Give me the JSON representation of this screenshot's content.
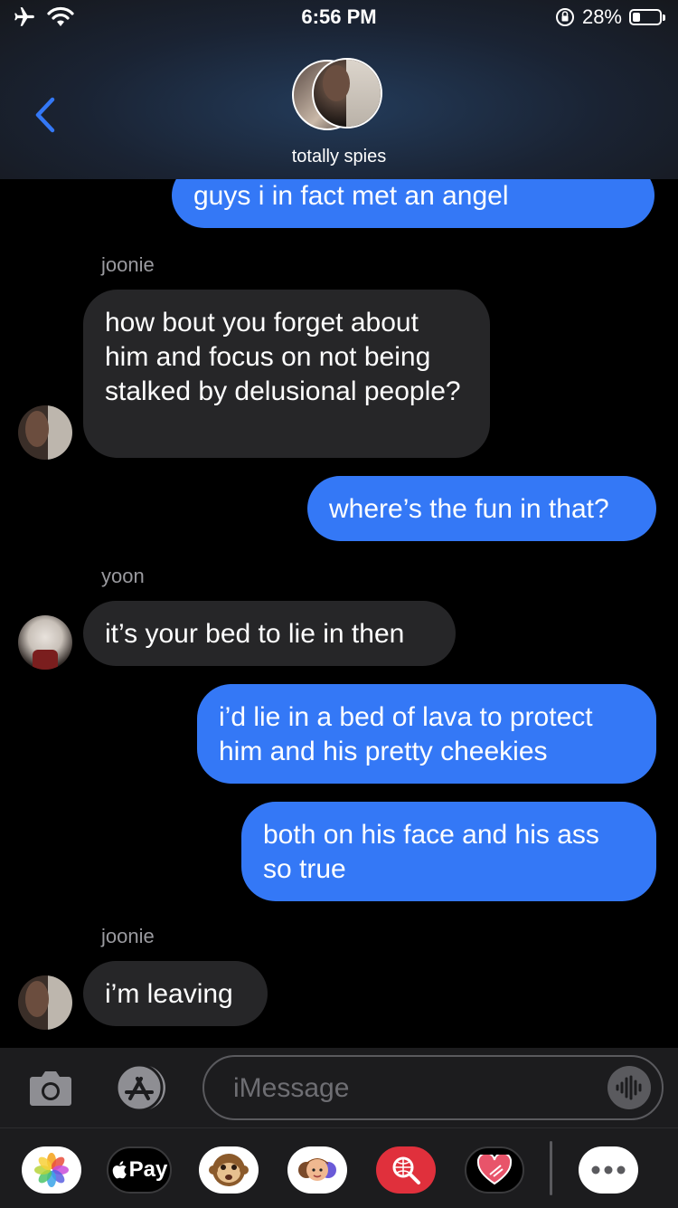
{
  "status": {
    "time": "6:56 PM",
    "battery": "28%",
    "battery_level": 0.28
  },
  "header": {
    "group_name": "totally spies",
    "back_label": ""
  },
  "messages": [
    {
      "type": "outgoing",
      "text": "guys i in fact met an angel"
    },
    {
      "type": "sender",
      "text": "joonie"
    },
    {
      "type": "incoming",
      "text": "how bout you forget about him and focus on not being stalked by delusional people?",
      "sender": "joonie"
    },
    {
      "type": "outgoing",
      "text": "where’s the fun in that?"
    },
    {
      "type": "sender",
      "text": "yoon"
    },
    {
      "type": "incoming",
      "text": "it’s your bed to lie in then",
      "sender": "yoon"
    },
    {
      "type": "outgoing",
      "text": "i’d lie in a bed of lava to protect him and his pretty cheekies"
    },
    {
      "type": "outgoing",
      "text": "both on his face and his ass so true"
    },
    {
      "type": "sender",
      "text": "joonie"
    },
    {
      "type": "incoming",
      "text": "i’m leaving",
      "sender": "joonie"
    }
  ],
  "composer": {
    "placeholder": "iMessage"
  },
  "drawer": {
    "apps": [
      "photos-icon",
      "apple-pay-icon",
      "monkey-memoji-icon",
      "memoji-icon",
      "search-images-icon",
      "heart-sticker-icon",
      "more-apps-icon"
    ],
    "pay_label": "Pay"
  },
  "colors": {
    "outgoing": "#3478f6",
    "incoming": "#262628",
    "accent": "#3478f6"
  }
}
